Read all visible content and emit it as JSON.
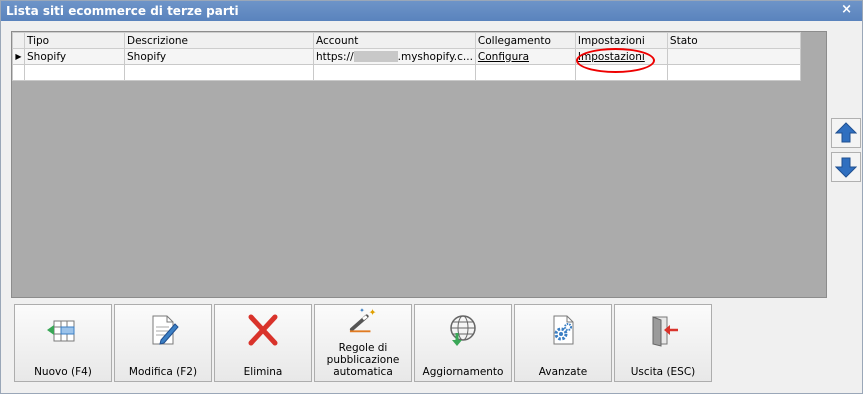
{
  "window": {
    "title": "Lista siti ecommerce di terze parti",
    "close_glyph": "×"
  },
  "grid": {
    "columns": [
      "Tipo",
      "Descrizione",
      "Account",
      "Collegamento",
      "Impostazioni",
      "Stato"
    ],
    "rows": [
      {
        "tipo": "Shopify",
        "descrizione": "Shopify",
        "account_prefix": "https://",
        "account_suffix": ".myshopify.c...",
        "collegamento": "Configura",
        "impostazioni": "Impostazioni",
        "stato": ""
      }
    ]
  },
  "side_buttons": {
    "up_icon": "arrow-up-icon",
    "down_icon": "arrow-down-icon"
  },
  "toolbar": [
    {
      "label": "Nuovo (F4)",
      "icon": "new-row-icon"
    },
    {
      "label": "Modifica (F2)",
      "icon": "edit-document-icon"
    },
    {
      "label": "Elimina",
      "icon": "delete-x-icon"
    },
    {
      "label": "Regole di pubblicazione automatica",
      "icon": "magic-wand-icon"
    },
    {
      "label": "Aggiornamento",
      "icon": "globe-download-icon"
    },
    {
      "label": "Avanzate",
      "icon": "gear-document-icon"
    },
    {
      "label": "Uscita (ESC)",
      "icon": "exit-door-icon"
    }
  ],
  "colors": {
    "titlebar": "#5a83bd",
    "grid_background": "#ababab",
    "highlight": "#ee0000",
    "delete_red": "#d9332b",
    "arrow_blue": "#2f6fc0"
  }
}
